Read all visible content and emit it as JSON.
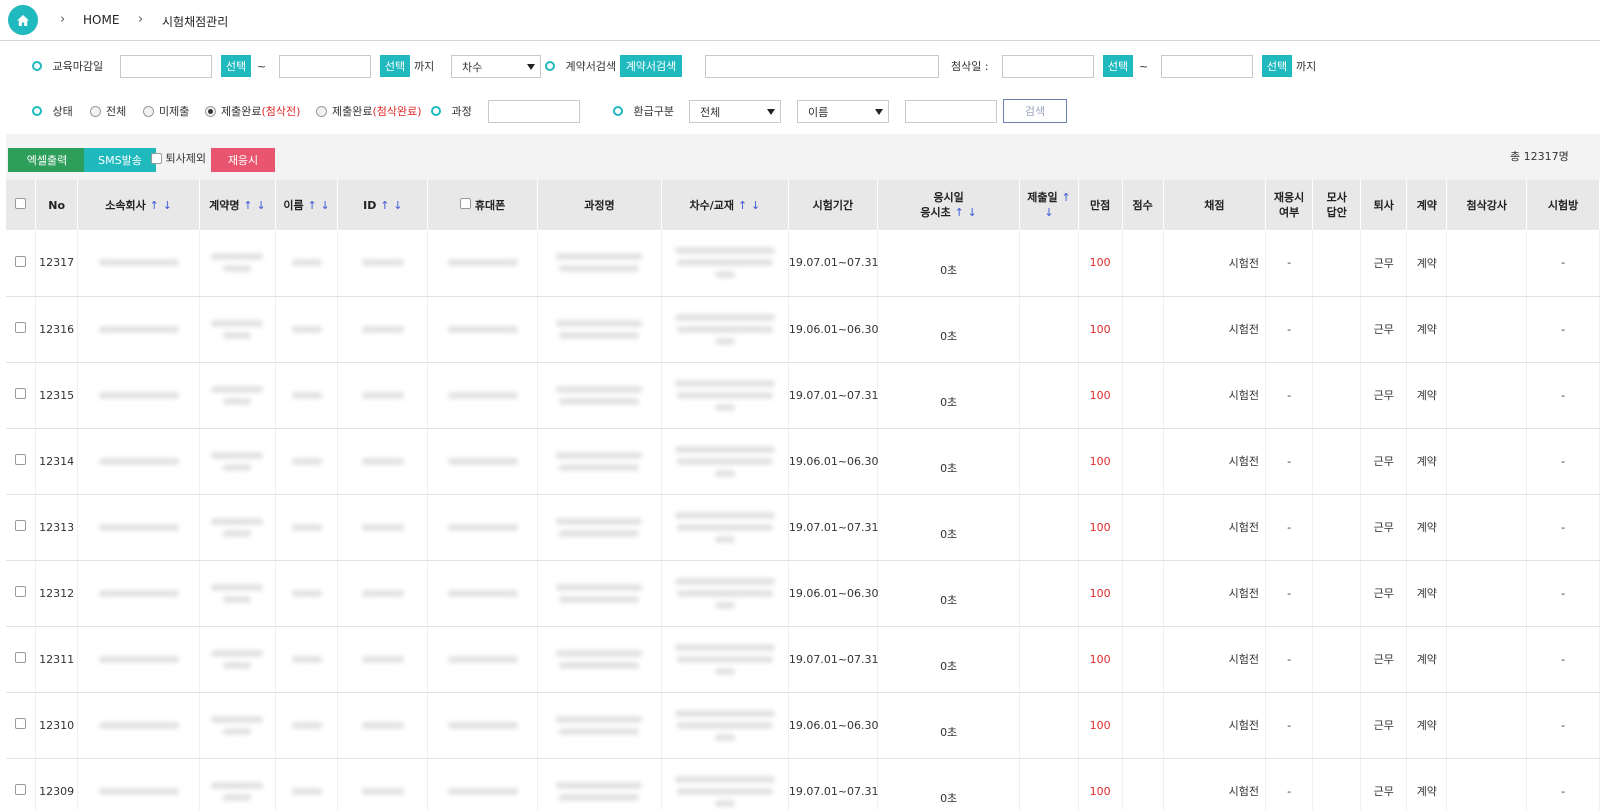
{
  "breadcrumb": {
    "home": "HOME",
    "current": "시험채점관리"
  },
  "filters": {
    "edu_deadline_label": "교육마감일",
    "select_label": "선택",
    "tilde": "~",
    "until_label": "까지",
    "round_select": "차수",
    "contract_search_label": "계약서검색",
    "contract_search_button": "계약서검색",
    "review_date_label": "첨삭일 :",
    "status_label": "상태",
    "status_options": [
      "전체",
      "미제출",
      "제출완료",
      "(첨삭전)",
      "제출완료",
      "(첨삭완료)"
    ],
    "course_label": "과정",
    "refund_label": "환급구분",
    "refund_select": "전체",
    "name_select": "이름",
    "search_button": "검색"
  },
  "toolbar": {
    "excel_button": "엑셀출력",
    "sms_button": "SMS발송",
    "exclude_resigned": "퇴사제외",
    "retake_button": "재응시",
    "total_count": "총 12317명"
  },
  "table": {
    "headers": {
      "no": "No",
      "company": "소속회사",
      "contract": "계약명",
      "name": "이름",
      "id": "ID",
      "phone": "휴대폰",
      "course": "과정명",
      "round": "차수/교재",
      "period": "시험기간",
      "exam_date_1": "응시일",
      "exam_date_2": "응시초",
      "submit_date": "제출일",
      "full_score": "만점",
      "score": "점수",
      "grading": "채점",
      "retake_1": "재응시",
      "retake_2": "여부",
      "mock_1": "모사",
      "mock_2": "답안",
      "resign": "퇴사",
      "contract_status": "계약",
      "tutor": "첨삭강사",
      "exam_room": "시험방"
    },
    "sort_up": "↑",
    "sort_down": "↓",
    "rows": [
      {
        "no": "12317",
        "period": "19.07.01~07.31",
        "duration": "0초",
        "full": "100",
        "grade": "시험전",
        "retake": "-",
        "resign": "근무",
        "contract": "계약",
        "room": "-"
      },
      {
        "no": "12316",
        "period": "19.06.01~06.30",
        "duration": "0초",
        "full": "100",
        "grade": "시험전",
        "retake": "-",
        "resign": "근무",
        "contract": "계약",
        "room": "-"
      },
      {
        "no": "12315",
        "period": "19.07.01~07.31",
        "duration": "0초",
        "full": "100",
        "grade": "시험전",
        "retake": "-",
        "resign": "근무",
        "contract": "계약",
        "room": "-"
      },
      {
        "no": "12314",
        "period": "19.06.01~06.30",
        "duration": "0초",
        "full": "100",
        "grade": "시험전",
        "retake": "-",
        "resign": "근무",
        "contract": "계약",
        "room": "-"
      },
      {
        "no": "12313",
        "period": "19.07.01~07.31",
        "duration": "0초",
        "full": "100",
        "grade": "시험전",
        "retake": "-",
        "resign": "근무",
        "contract": "계약",
        "room": "-"
      },
      {
        "no": "12312",
        "period": "19.06.01~06.30",
        "duration": "0초",
        "full": "100",
        "grade": "시험전",
        "retake": "-",
        "resign": "근무",
        "contract": "계약",
        "room": "-"
      },
      {
        "no": "12311",
        "period": "19.07.01~07.31",
        "duration": "0초",
        "full": "100",
        "grade": "시험전",
        "retake": "-",
        "resign": "근무",
        "contract": "계약",
        "room": "-"
      },
      {
        "no": "12310",
        "period": "19.06.01~06.30",
        "duration": "0초",
        "full": "100",
        "grade": "시험전",
        "retake": "-",
        "resign": "근무",
        "contract": "계약",
        "room": "-"
      },
      {
        "no": "12309",
        "period": "19.07.01~07.31",
        "duration": "0초",
        "full": "100",
        "grade": "시험전",
        "retake": "-",
        "resign": "근무",
        "contract": "계약",
        "room": "-"
      }
    ]
  },
  "colors": {
    "teal": "#1fb9be",
    "green": "#2e9e5b",
    "pink": "#e9556e",
    "red": "#e02b2b",
    "sort_blue": "#3b5bd6"
  }
}
